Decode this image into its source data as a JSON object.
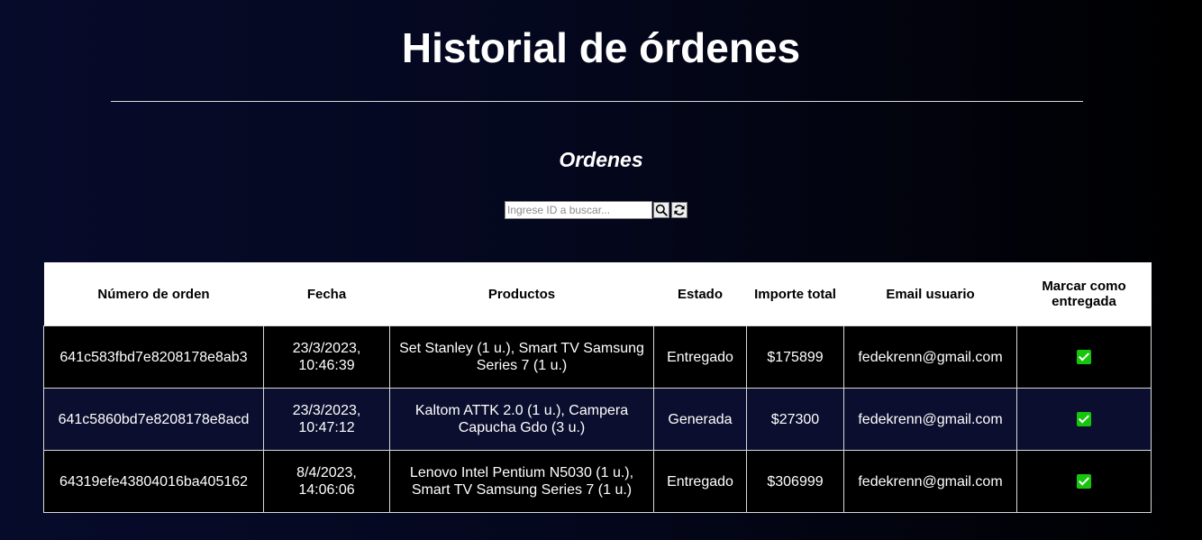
{
  "page": {
    "title": "Historial de órdenes",
    "section_title": "Ordenes"
  },
  "search": {
    "placeholder": "Ingrese ID a buscar...",
    "value": "",
    "search_icon": "search-icon",
    "refresh_icon": "refresh-icon"
  },
  "table": {
    "headers": {
      "order_number": "Número de orden",
      "date": "Fecha",
      "products": "Productos",
      "status": "Estado",
      "total": "Importe total",
      "email": "Email usuario",
      "mark_delivered": "Marcar como entregada"
    },
    "rows": [
      {
        "order_number": "641c583fbd7e8208178e8ab3",
        "date": "23/3/2023, 10:46:39",
        "products": "Set Stanley (1 u.), Smart TV Samsung Series 7 (1 u.)",
        "status": "Entregado",
        "total": "$175899",
        "email": "fedekrenn@gmail.com",
        "mark_icon": "check-mark-button-icon"
      },
      {
        "order_number": "641c5860bd7e8208178e8acd",
        "date": "23/3/2023, 10:47:12",
        "products": "Kaltom ATTK 2.0 (1 u.), Campera Capucha Gdo (3 u.)",
        "status": "Generada",
        "total": "$27300",
        "email": "fedekrenn@gmail.com",
        "mark_icon": "check-mark-button-icon"
      },
      {
        "order_number": "64319efe43804016ba405162",
        "date": "8/4/2023, 14:06:06",
        "products": "Lenovo Intel Pentium N5030 (1 u.), Smart TV Samsung Series 7 (1 u.)",
        "status": "Entregado",
        "total": "$306999",
        "email": "fedekrenn@gmail.com",
        "mark_icon": "check-mark-button-icon"
      }
    ]
  },
  "colors": {
    "background_left": "#070b2b",
    "background_right": "#000000",
    "row_alt": "#0b0e2e",
    "check_green": "#16c60c"
  }
}
